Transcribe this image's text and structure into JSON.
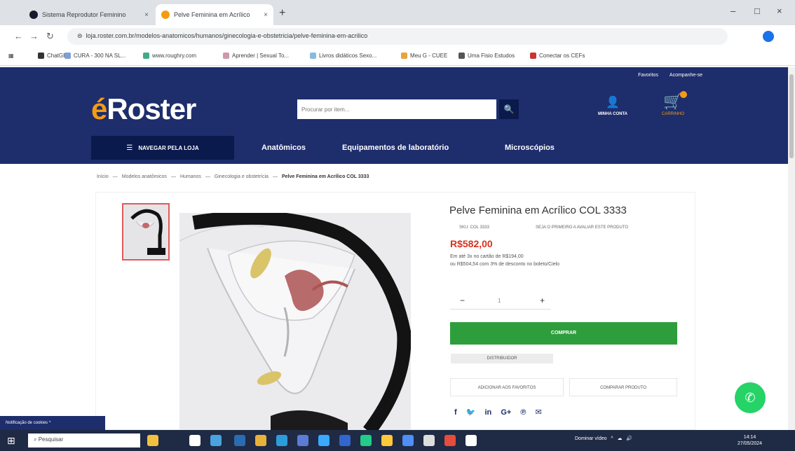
{
  "browser": {
    "tabs": [
      {
        "label": "Sistema Reprodutor Feminino",
        "close": "×"
      },
      {
        "label": "Pelve Feminina em Acrílico",
        "close": "×"
      }
    ],
    "new_tab": "+",
    "window_controls": {
      "minimize": "–",
      "maximize": "□",
      "close": "×"
    },
    "nav": {
      "back": "←",
      "forward": "→",
      "reload": "↻",
      "info": "⊜"
    },
    "url": "loja.roster.com.br/modelos-anatomicos/humanos/ginecologia-e-obstetricia/pelve-feminina-em-acrilico",
    "bookmarks": [
      "ChatGPT",
      "CURA - 300 NA SL...",
      "www.roughry.com",
      "Aprender | Sexual To...",
      "Livros didáticos Sexo...",
      "Meu G - CUEE",
      "Uma Fisio Estudos",
      "Conectar os CEFs"
    ]
  },
  "site": {
    "top_links": [
      "Favoritos",
      "Acompanhe-se"
    ],
    "logo": {
      "mark": "é",
      "text": "Roster"
    },
    "search": {
      "placeholder": "Procurar por item...",
      "button": "🔍"
    },
    "account": {
      "icon": "👤",
      "label": "MINHA CONTA"
    },
    "cart": {
      "icon": "🛒",
      "label": "CARRINHO"
    },
    "menu_button": {
      "icon": "☰",
      "label": "NAVEGAR PELA LOJA"
    },
    "nav_links": [
      "Anatômicos",
      "Equipamentos de laboratório",
      "Microscópios"
    ]
  },
  "breadcrumb": {
    "items": [
      "Início",
      "Modelos anatômicos",
      "Humanos",
      "Ginecologia e obstetrícia"
    ],
    "separator": "—",
    "current": "Pelve Feminina em Acrílico COL 3333"
  },
  "product": {
    "title": "Pelve Feminina em Acrílico COL 3333",
    "sku": "SKU: COL 3333",
    "review_link": "SEJA O PRIMEIRO A AVALIAR ESTE PRODUTO",
    "price": "R$582,00",
    "installments": "Em até 3x no cartão de R$194,00",
    "discount": "ou R$504,54 com 3% de desconto no boleto/Cielo",
    "qty": {
      "minus": "−",
      "value": "1",
      "plus": "+"
    },
    "buy_button": "COMPRAR",
    "sold_by": "DISTRIBUIDOR",
    "wishlist_button": "ADICIONAR AOS FAVORITOS",
    "compare_button": "COMPARAR PRODUTO",
    "share": [
      "f",
      "🐦",
      "in",
      "G+",
      "℗",
      "✉"
    ]
  },
  "whatsapp": {
    "icon": "✆"
  },
  "cookie_bar": "Notificação de cookies ^",
  "taskbar": {
    "start": "⊞",
    "search_placeholder": "Pesquisar",
    "tray_text": "Dominar vídeo",
    "time": "14:14",
    "date": "27/05/2024"
  },
  "colors": {
    "header_bg": "#1e2d6b",
    "accent": "#f39c12",
    "price": "#d9301d",
    "buy": "#2e9e3c",
    "whatsapp": "#25d366"
  }
}
